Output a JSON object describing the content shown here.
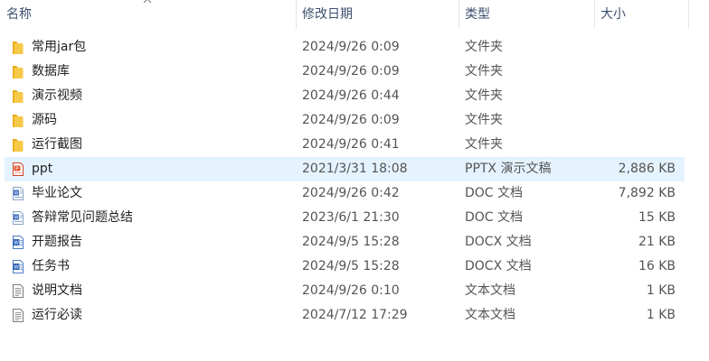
{
  "header": {
    "name": "名称",
    "date": "修改日期",
    "type": "类型",
    "size": "大小"
  },
  "files": [
    {
      "name": "常用jar包",
      "date": "2024/9/26 0:09",
      "type": "文件夹",
      "size": "",
      "icon": "folder-icon"
    },
    {
      "name": "数据库",
      "date": "2024/9/26 0:09",
      "type": "文件夹",
      "size": "",
      "icon": "folder-icon"
    },
    {
      "name": "演示视频",
      "date": "2024/9/26 0:44",
      "type": "文件夹",
      "size": "",
      "icon": "folder-icon"
    },
    {
      "name": "源码",
      "date": "2024/9/26 0:09",
      "type": "文件夹",
      "size": "",
      "icon": "folder-icon"
    },
    {
      "name": "运行截图",
      "date": "2024/9/26 0:41",
      "type": "文件夹",
      "size": "",
      "icon": "folder-icon"
    },
    {
      "name": "ppt",
      "date": "2021/3/31 18:08",
      "type": "PPTX 演示文稿",
      "size": "2,886 KB",
      "icon": "powerpoint-file-icon"
    },
    {
      "name": "毕业论文",
      "date": "2024/9/26 0:42",
      "type": "DOC 文档",
      "size": "7,892 KB",
      "icon": "word-doc-icon"
    },
    {
      "name": "答辩常见问题总结",
      "date": "2023/6/1 21:30",
      "type": "DOC 文档",
      "size": "15 KB",
      "icon": "word-doc-icon"
    },
    {
      "name": "开题报告",
      "date": "2024/9/5 15:28",
      "type": "DOCX 文档",
      "size": "21 KB",
      "icon": "word-docx-icon"
    },
    {
      "name": "任务书",
      "date": "2024/9/5 15:28",
      "type": "DOCX 文档",
      "size": "16 KB",
      "icon": "word-docx-icon"
    },
    {
      "name": "说明文档",
      "date": "2024/9/26 0:10",
      "type": "文本文档",
      "size": "1 KB",
      "icon": "text-file-icon"
    },
    {
      "name": "运行必读",
      "date": "2024/7/12 17:29",
      "type": "文本文档",
      "size": "1 KB",
      "icon": "text-file-icon"
    }
  ],
  "hovered_file": "ppt",
  "colors": {
    "folder": "#f5c344",
    "hover_bg": "#e5f3ff",
    "powerpoint": "#e05a34",
    "word": "#2b62b8"
  }
}
